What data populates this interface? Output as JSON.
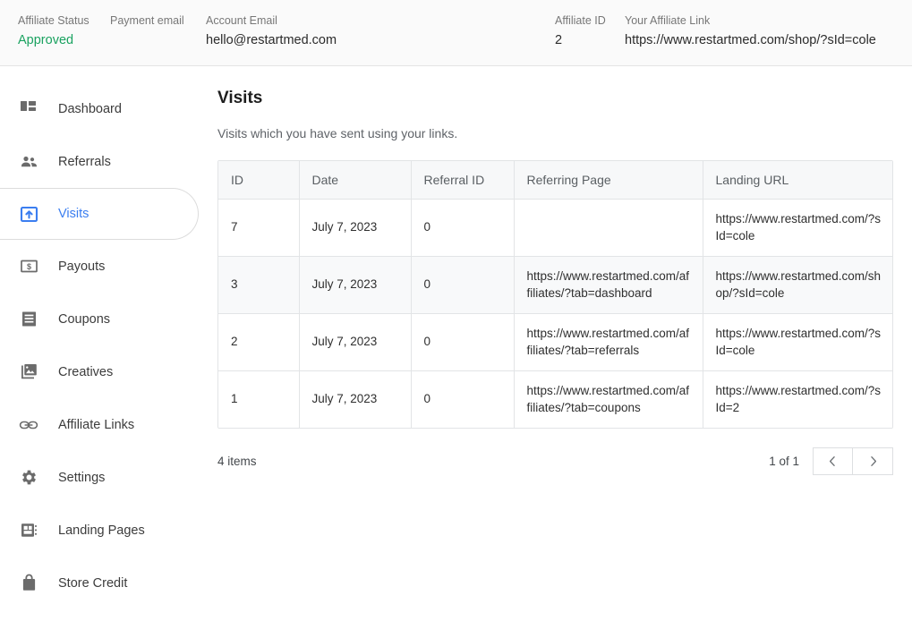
{
  "topbar": {
    "stats": [
      {
        "label": "Affiliate Status",
        "value": "Approved",
        "color": "#1aa260"
      },
      {
        "label": "Payment email",
        "value": ""
      },
      {
        "label": "Account Email",
        "value": "hello@restartmed.com"
      },
      {
        "label": "Affiliate ID",
        "value": "2"
      },
      {
        "label": "Your Affiliate Link",
        "value": "https://www.restartmed.com/shop/?sId=cole"
      }
    ]
  },
  "sidebar": {
    "items": [
      {
        "label": "Dashboard",
        "icon": "dashboard-grid-icon",
        "active": false
      },
      {
        "label": "Referrals",
        "icon": "people-icon",
        "active": false
      },
      {
        "label": "Visits",
        "icon": "export-box-icon",
        "active": true
      },
      {
        "label": "Payouts",
        "icon": "money-bill-icon",
        "active": false
      },
      {
        "label": "Coupons",
        "icon": "receipt-icon",
        "active": false
      },
      {
        "label": "Creatives",
        "icon": "image-stack-icon",
        "active": false
      },
      {
        "label": "Affiliate Links",
        "icon": "chain-link-icon",
        "active": false
      },
      {
        "label": "Settings",
        "icon": "gear-icon",
        "active": false
      },
      {
        "label": "Landing Pages",
        "icon": "layout-page-icon",
        "active": false
      },
      {
        "label": "Store Credit",
        "icon": "shopping-bag-icon",
        "active": false
      }
    ],
    "active_color": "#3b7ef0"
  },
  "main": {
    "title": "Visits",
    "subtitle": "Visits which you have sent using your links.",
    "table": {
      "columns": [
        "ID",
        "Date",
        "Referral ID",
        "Referring Page",
        "Landing URL"
      ],
      "rows": [
        {
          "id": "7",
          "date": "July 7, 2023",
          "referral_id": "0",
          "referring_page": "",
          "landing_url": "https://www.restartmed.com/?sId=cole",
          "striped": false
        },
        {
          "id": "3",
          "date": "July 7, 2023",
          "referral_id": "0",
          "referring_page": "https://www.restartmed.com/affiliates/?tab=dashboard",
          "landing_url": "https://www.restartmed.com/shop/?sId=cole",
          "striped": true
        },
        {
          "id": "2",
          "date": "July 7, 2023",
          "referral_id": "0",
          "referring_page": "https://www.restartmed.com/affiliates/?tab=referrals",
          "landing_url": "https://www.restartmed.com/?sId=cole",
          "striped": false
        },
        {
          "id": "1",
          "date": "July 7, 2023",
          "referral_id": "0",
          "referring_page": "https://www.restartmed.com/affiliates/?tab=coupons",
          "landing_url": "https://www.restartmed.com/?sId=2",
          "striped": false
        }
      ]
    },
    "pagination": {
      "items_count": "4 items",
      "page_label": "1 of 1",
      "prev_icon": "chevron-left-icon",
      "next_icon": "chevron-right-icon"
    }
  }
}
